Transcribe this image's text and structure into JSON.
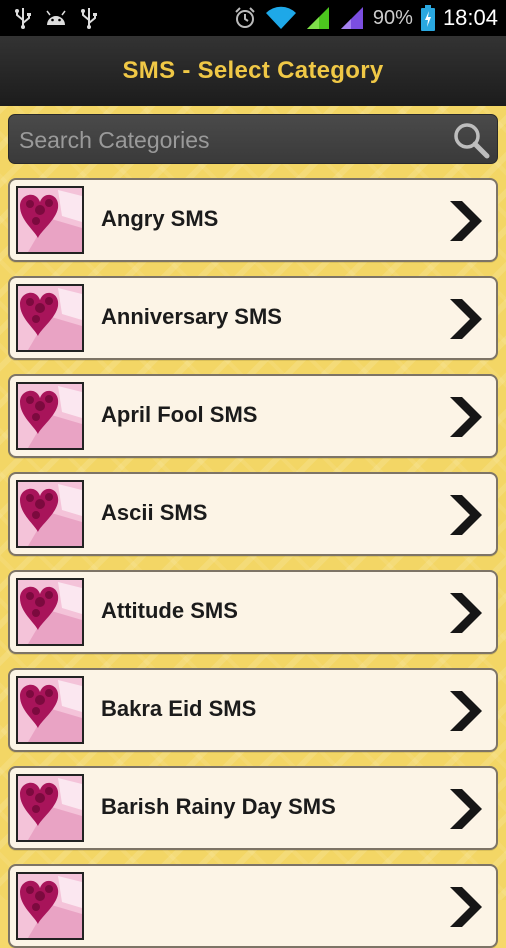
{
  "status_bar": {
    "left_icons": [
      "usb-icon",
      "android-icon",
      "usb-icon"
    ],
    "right_icons": [
      "alarm-icon",
      "wifi-icon",
      "signal-icon",
      "signal-roaming-icon",
      "battery-charging-icon"
    ],
    "battery_percent": "90%",
    "time": "18:04"
  },
  "header": {
    "title": "SMS - Select Category",
    "title_color": "#f0c846"
  },
  "search": {
    "placeholder": "Search Categories",
    "icon": "search-icon"
  },
  "categories": {
    "items": [
      {
        "label": "Angry SMS"
      },
      {
        "label": "Anniversary SMS"
      },
      {
        "label": "April Fool SMS"
      },
      {
        "label": "Ascii SMS"
      },
      {
        "label": "Attitude SMS"
      },
      {
        "label": "Bakra Eid SMS"
      },
      {
        "label": "Barish Rainy Day SMS"
      },
      {
        "label": ""
      }
    ],
    "thumbnail_icon": "heart-roses-icon",
    "chevron_icon": "chevron-right-icon"
  },
  "colors": {
    "background": "#f3d665",
    "item_background": "#fcf4e6",
    "title_bar": "#262626"
  }
}
